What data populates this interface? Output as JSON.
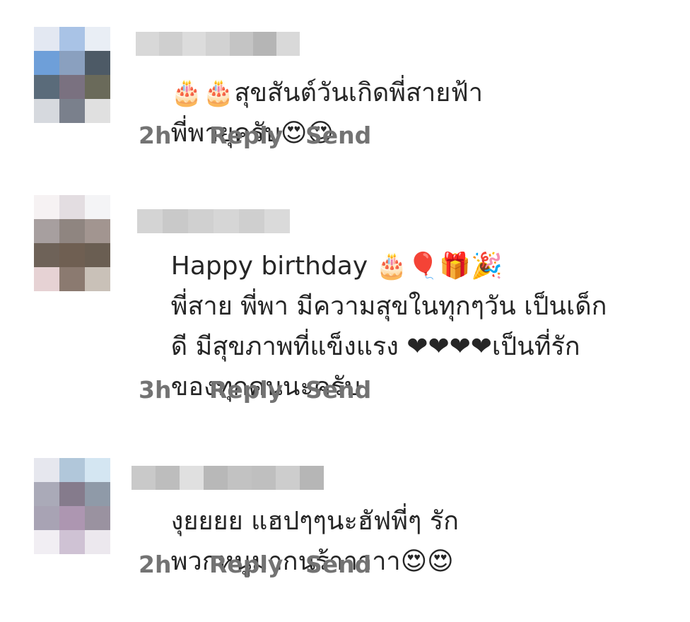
{
  "comments": [
    {
      "text_line1": "🎂🎂สุขสันต์วันเกิดพี่สายฟ้า",
      "text_line2": "พี่พายุครับ😍😍",
      "time": "2h",
      "reply_label": "Reply",
      "send_label": "Send"
    },
    {
      "text_line1": "Happy birthday 🎂🎈🎁🎉",
      "text_line2": "พี่สาย พี่พา มีความสุขในทุกๆวัน เป็นเด็ก",
      "text_line3": "ดี มีสุขภาพที่แข็งแรง ❤❤❤❤เป็นที่รัก",
      "text_line4": "ของทุกคนนะครับ",
      "time": "3h",
      "reply_label": "Reply",
      "send_label": "Send"
    },
    {
      "text_line1": "งุยยยย แฮปๆๆนะฮัฟพี่ๆ รัก",
      "text_line2": "พวกหนูมากนร้าาาาา😍😍",
      "time": "2h",
      "reply_label": "Reply",
      "send_label": "Send"
    }
  ],
  "colors": {
    "text": "#262626",
    "meta": "#737373"
  }
}
